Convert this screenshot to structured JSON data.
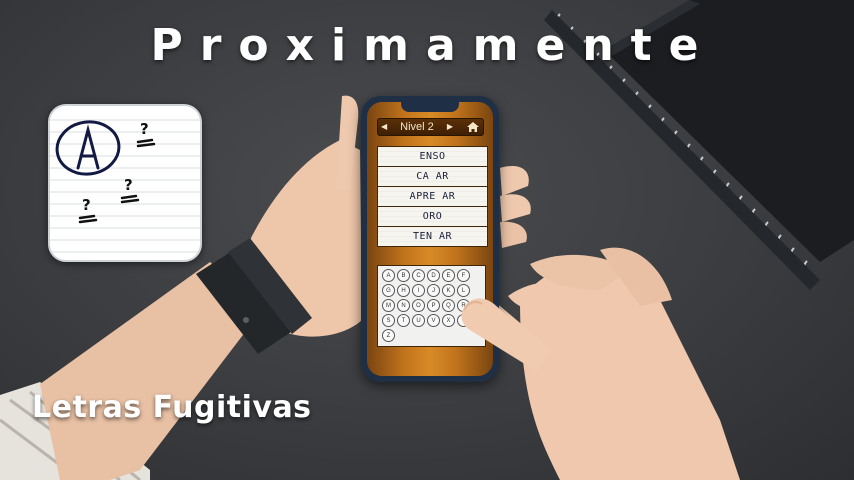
{
  "headline": "Proximamente",
  "subtitle": "Letras Fugitivas",
  "game": {
    "level_label": "Nivel 2",
    "words": [
      "ENSO",
      "CA AR",
      "APRE AR",
      "ORO",
      "TEN AR"
    ],
    "keyboard_rows": [
      [
        "A",
        "B",
        "C",
        "D",
        "E",
        "F"
      ],
      [
        "G",
        "H",
        "I",
        "J",
        "K",
        "L"
      ],
      [
        "M",
        "N",
        "O",
        "P",
        "Q",
        "R"
      ],
      [
        "S",
        "T",
        "U",
        "V",
        "X",
        "Y"
      ],
      [
        "Z"
      ]
    ]
  },
  "icons": {
    "app_icon": "letter-a-circled-with-question-marks",
    "prev": "triangle-left",
    "next": "triangle-right",
    "home": "home-icon"
  },
  "colors": {
    "phone_frame": "#1f3046",
    "wood": "#c2741c",
    "ink": "#1a1f3a"
  }
}
